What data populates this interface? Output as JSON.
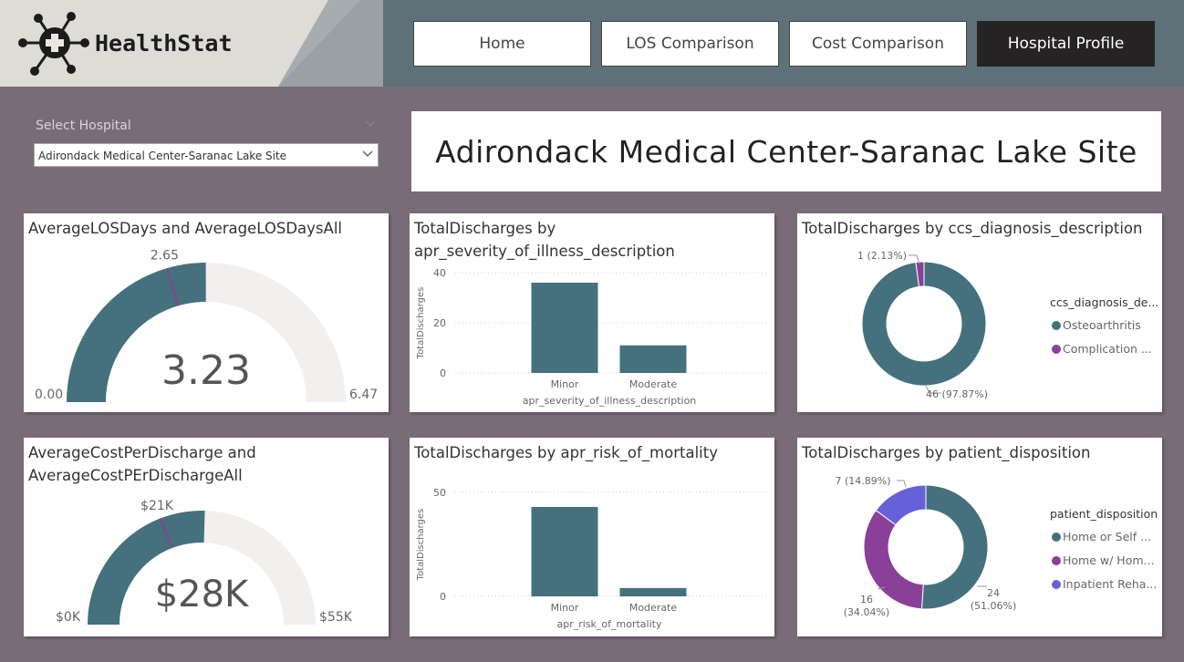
{
  "header": {
    "logo_text": "HealthStat",
    "nav": [
      "Home",
      "LOS Comparison",
      "Cost Comparison",
      "Hospital Profile"
    ],
    "active_nav": "Hospital Profile"
  },
  "filter": {
    "label": "Select Hospital",
    "selected": "Adirondack Medical Center-Saranac Lake Site"
  },
  "page_title": "Adirondack Medical Center-Saranac Lake Site",
  "colors": {
    "teal": "#44717d",
    "purple": "#8a3f98",
    "indigo": "#6661d8",
    "track": "#f1f0ef"
  },
  "gauges": [
    {
      "title": "AverageLOSDays and AverageLOSDaysAll",
      "min": 0.0,
      "max": 6.47,
      "value": 3.23,
      "target": 2.65,
      "min_label": "0.00",
      "max_label": "6.47",
      "value_label": "3.23",
      "target_label": "2.65"
    },
    {
      "title": "AverageCostPerDischarge and AverageCostPErDischargeAll",
      "min": 0,
      "max": 55,
      "value": 28,
      "target": 21,
      "min_label": "$0K",
      "max_label": "$55K",
      "value_label": "$28K",
      "target_label": "$21K"
    }
  ],
  "chart_data": [
    {
      "type": "bar",
      "title": "TotalDischarges by apr_severity_of_illness_description",
      "categories": [
        "Minor",
        "Moderate"
      ],
      "values": [
        36,
        11
      ],
      "xlabel": "apr_severity_of_illness_description",
      "ylabel": "TotalDischarges",
      "ylim": [
        0,
        40
      ],
      "yticks": [
        "0",
        "20",
        "40"
      ],
      "grid": true
    },
    {
      "type": "bar",
      "title": "TotalDischarges by apr_risk_of_mortality",
      "categories": [
        "Minor",
        "Moderate"
      ],
      "values": [
        43,
        4
      ],
      "xlabel": "apr_risk_of_mortality",
      "ylabel": "TotalDischarges",
      "ylim": [
        0,
        50
      ],
      "yticks": [
        "0",
        "50"
      ],
      "grid": true
    },
    {
      "type": "pie",
      "title": "TotalDischarges by ccs_diagnosis_description",
      "legend_title": "ccs_diagnosis_de...",
      "slices": [
        {
          "label": "Osteoarthritis",
          "value": 46,
          "text": "46 (97.87%)"
        },
        {
          "label": "Complication ...",
          "value": 1,
          "text": "1 (2.13%)"
        }
      ]
    },
    {
      "type": "pie",
      "title": "TotalDischarges by patient_disposition",
      "legend_title": "patient_disposition",
      "slices": [
        {
          "label": "Home or Self ...",
          "value": 24,
          "text": "24 (51.06%)"
        },
        {
          "label": "Home w/ Hom...",
          "value": 16,
          "text": "16 (34.04%)"
        },
        {
          "label": "Inpatient Reha...",
          "value": 7,
          "text": "7 (14.89%)"
        }
      ]
    }
  ]
}
